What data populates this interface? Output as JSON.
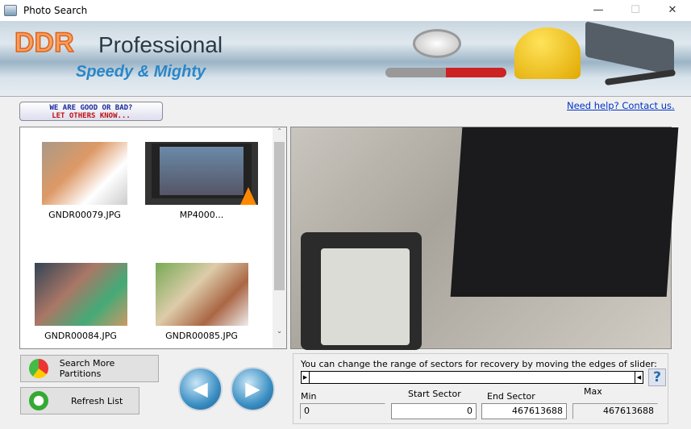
{
  "window": {
    "title": "Photo Search",
    "minimize": "—",
    "maximize": "☐",
    "close": "✕"
  },
  "banner": {
    "brand": "DDR",
    "product": "Professional",
    "tagline": "Speedy & Mighty"
  },
  "feedback": {
    "line1": "WE ARE GOOD OR BAD?",
    "line2": "LET OTHERS KNOW..."
  },
  "help_link": "Need help? Contact us.",
  "files": [
    {
      "name": "GNDR00079.JPG"
    },
    {
      "name": "MP4000..."
    },
    {
      "name": "GNDR00084.JPG"
    },
    {
      "name": "GNDR00085.JPG"
    }
  ],
  "buttons": {
    "search_more": "Search More Partitions",
    "refresh": "Refresh List",
    "prev": "◀",
    "next": "▶"
  },
  "sectors": {
    "instruction": "You can change the range of sectors for recovery by moving the edges of slider:",
    "help": "?",
    "min_label": "Min",
    "min_value": "0",
    "start_label": "Start Sector",
    "start_value": "0",
    "end_label": "End Sector",
    "end_value": "467613688",
    "max_label": "Max",
    "max_value": "467613688"
  }
}
